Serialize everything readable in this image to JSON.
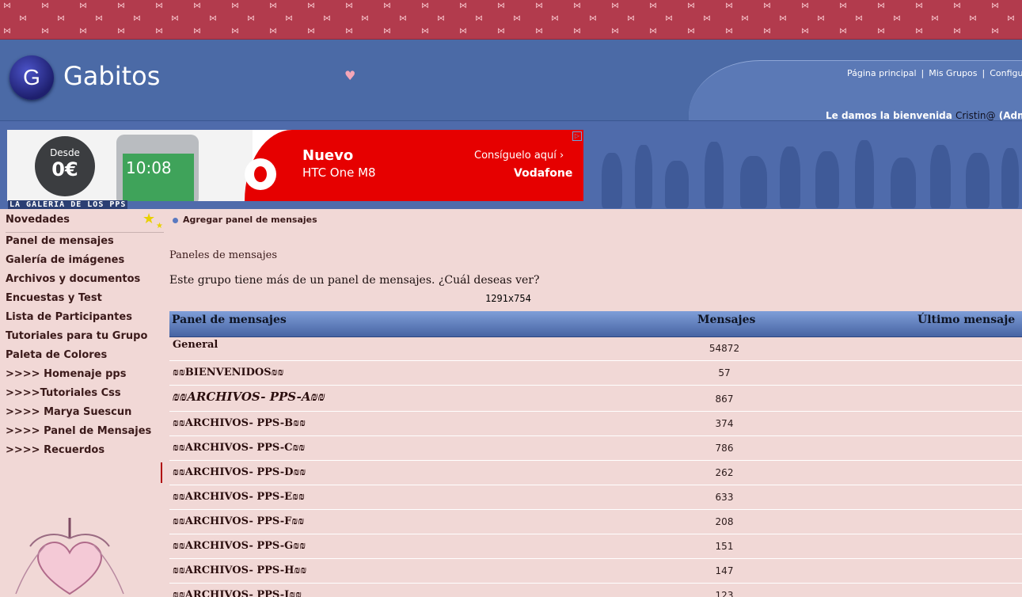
{
  "header": {
    "brand": "Gabitos",
    "logo_letter": "G",
    "nav": [
      "Página principal",
      "Mis Grupos",
      "Configuraci"
    ],
    "welcome_prefix": "Le damos la bienvenida",
    "welcome_user": "Cristin@",
    "welcome_suffix": "(Adm"
  },
  "ad": {
    "badge_small": "Desde",
    "badge_big": "0€",
    "phone_time": "10:08",
    "headline": "Nuevo",
    "model": "HTC One M8",
    "cta": "Consíguelo aquí ›",
    "advertiser": "Vodafone"
  },
  "banner_caption": "LA GALERIA DE LOS PPS",
  "sidebar": {
    "title": "Novedades",
    "items": [
      "Panel de mensajes",
      "Galería de imágenes",
      "Archivos y documentos",
      "Encuestas y Test",
      "Lista de Participantes",
      "Tutoriales para tu Grupo",
      "Paleta de Colores",
      ">>>> Homenaje pps",
      ">>>>Tutoriales Css",
      ">>>> Marya Suescun",
      ">>>> Panel de Mensajes",
      ">>>> Recuerdos"
    ]
  },
  "main": {
    "add_link": "Agregar panel de mensajes",
    "heading": "Paneles de mensajes",
    "question": "Este grupo tiene más de un panel de mensajes. ¿Cuál deseas ver?",
    "dims": "1291x754",
    "columns": {
      "board": "Panel de mensajes",
      "count": "Mensajes",
      "last": "Último mensaje"
    },
    "rows": [
      {
        "name": "General",
        "count": "54872"
      },
      {
        "name": "₪₪BIENVENIDOS₪₪",
        "count": "57"
      },
      {
        "name": "₪₪ARCHIVOS-  PPS-A₪₪",
        "count": "867"
      },
      {
        "name": "₪₪ARCHIVOS- PPS-B₪₪",
        "count": "374"
      },
      {
        "name": "₪₪ARCHIVOS- PPS-C₪₪",
        "count": "786"
      },
      {
        "name": "₪₪ARCHIVOS- PPS-D₪₪",
        "count": "262"
      },
      {
        "name": "₪₪ARCHIVOS- PPS-E₪₪",
        "count": "633"
      },
      {
        "name": "₪₪ARCHIVOS- PPS-F₪₪",
        "count": "208"
      },
      {
        "name": "₪₪ARCHIVOS- PPS-G₪₪",
        "count": "151"
      },
      {
        "name": "₪₪ARCHIVOS- PPS-H₪₪",
        "count": "147"
      },
      {
        "name": "₪₪ARCHIVOS- PPS-I₪₪",
        "count": "123"
      }
    ]
  }
}
